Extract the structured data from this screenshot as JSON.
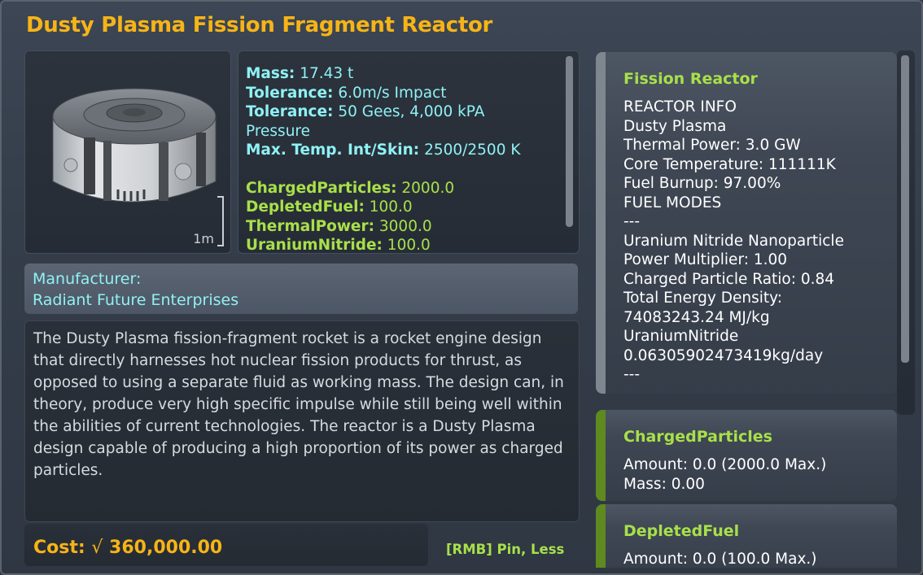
{
  "title": "Dusty Plasma Fission Fragment Reactor",
  "scale_label": "1m",
  "stats": {
    "mass_label": "Mass:",
    "mass_value": " 17.43 t",
    "tol1_label": "Tolerance:",
    "tol1_value": " 6.0m/s Impact",
    "tol2_label": "Tolerance:",
    "tol2_value": " 50 Gees, 4,000 kPA",
    "tol2_cont": "Pressure",
    "temp_label": "Max. Temp. Int/Skin:",
    "temp_value": " 2500/2500 K",
    "resources": [
      {
        "label": "ChargedParticles:",
        "value": " 2000.0"
      },
      {
        "label": "DepletedFuel:",
        "value": " 100.0"
      },
      {
        "label": "ThermalPower:",
        "value": " 3000.0"
      },
      {
        "label": "UraniumNitride:",
        "value": " 100.0"
      }
    ]
  },
  "manufacturer": {
    "label": "Manufacturer:",
    "name": "Radiant Future Enterprises"
  },
  "description": "The Dusty Plasma fission-fragment rocket is a rocket engine design that directly harnesses hot nuclear fission products for thrust, as opposed to using a separate fluid as working mass. The design can, in theory, produce very high specific impulse while still being well within the abilities of current technologies. The reactor is a Dusty Plasma design capable of producing a high proportion of its power as charged particles.",
  "cost": {
    "label": "Cost:",
    "symbol": "√",
    "value": "360,000.00"
  },
  "pin_hint": "[RMB] Pin, Less",
  "modules": {
    "reactor": {
      "title": "Fission Reactor",
      "lines": [
        "REACTOR INFO",
        "Dusty Plasma",
        "Thermal Power: 3.0 GW",
        "Core Temperature: 111111K",
        "Fuel Burnup: 97.00%",
        "FUEL MODES",
        "---",
        "Uranium Nitride Nanoparticle",
        "Power Multiplier: 1.00",
        "Charged Particle Ratio: 0.84",
        "Total Energy Density:",
        "74083243.24 MJ/kg",
        "UraniumNitride",
        "0.06305902473419kg/day",
        "---"
      ]
    },
    "charged": {
      "title": "ChargedParticles",
      "lines": [
        "Amount: 0.0 (2000.0 Max.)",
        "Mass: 0.00"
      ]
    },
    "depleted": {
      "title": "DepletedFuel",
      "lines": [
        "Amount: 0.0 (100.0 Max.)"
      ]
    }
  },
  "colors": {
    "accent": "#f7b417",
    "cyan": "#8ff1f4",
    "green": "#a8e04a"
  },
  "icons": [
    "reactor-part-thumbnail",
    "funds-icon"
  ]
}
